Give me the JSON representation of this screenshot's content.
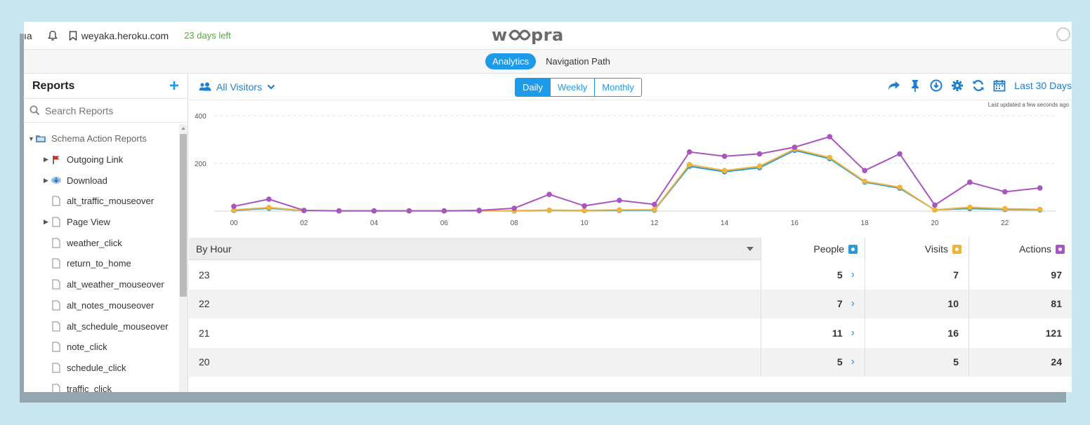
{
  "topbar": {
    "left_fragment": "ıa",
    "domain": "weyaka.heroku.com",
    "days_left": "23 days left",
    "logo": "woopra"
  },
  "subnav": {
    "tabs": [
      {
        "label": "Analytics",
        "active": true
      },
      {
        "label": "Navigation Path",
        "active": false
      }
    ]
  },
  "sidebar": {
    "title": "Reports",
    "search_placeholder": "Search Reports",
    "tree": [
      {
        "label": "Schema Action Reports",
        "icon": "folder-icon",
        "expanded": true,
        "level": 0
      },
      {
        "label": "Outgoing Link",
        "icon": "flag-icon",
        "expandable": true,
        "level": 1
      },
      {
        "label": "Download",
        "icon": "download-icon",
        "expandable": true,
        "level": 1
      },
      {
        "label": "alt_traffic_mouseover",
        "icon": "page-icon",
        "level": 1
      },
      {
        "label": "Page View",
        "icon": "page-icon",
        "expandable": true,
        "level": 1
      },
      {
        "label": "weather_click",
        "icon": "page-icon",
        "level": 1
      },
      {
        "label": "return_to_home",
        "icon": "page-icon",
        "level": 1
      },
      {
        "label": "alt_weather_mouseover",
        "icon": "page-icon",
        "level": 1
      },
      {
        "label": "alt_notes_mouseover",
        "icon": "page-icon",
        "level": 1
      },
      {
        "label": "alt_schedule_mouseover",
        "icon": "page-icon",
        "level": 1
      },
      {
        "label": "note_click",
        "icon": "page-icon",
        "level": 1
      },
      {
        "label": "schedule_click",
        "icon": "page-icon",
        "level": 1
      },
      {
        "label": "traffic_click",
        "icon": "page-icon",
        "level": 1
      }
    ]
  },
  "toolbar": {
    "segment": "All Visitors",
    "periods": [
      "Daily",
      "Weekly",
      "Monthly"
    ],
    "active_period": "Daily",
    "date_range": "Last 30 Days",
    "last_updated": "Last updated a few seconds ago"
  },
  "chart_data": {
    "type": "line",
    "x": [
      "00",
      "01",
      "02",
      "03",
      "04",
      "05",
      "06",
      "07",
      "08",
      "09",
      "10",
      "11",
      "12",
      "13",
      "14",
      "15",
      "16",
      "17",
      "18",
      "19",
      "20",
      "21",
      "22",
      "23"
    ],
    "x_ticks": [
      "00",
      "02",
      "04",
      "06",
      "08",
      "10",
      "12",
      "14",
      "16",
      "18",
      "20",
      "22"
    ],
    "y_ticks": [
      "200",
      "400"
    ],
    "ylim": [
      0,
      400
    ],
    "grid": true,
    "series": [
      {
        "name": "People",
        "color": "#2b9ad6",
        "values": [
          3,
          12,
          2,
          1,
          1,
          1,
          1,
          1,
          1,
          3,
          2,
          3,
          4,
          188,
          165,
          182,
          255,
          220,
          122,
          96,
          5,
          11,
          7,
          5
        ]
      },
      {
        "name": "Visits",
        "color": "#f0b43a",
        "values": [
          5,
          15,
          2,
          1,
          1,
          1,
          1,
          1,
          2,
          4,
          3,
          5,
          6,
          195,
          170,
          188,
          260,
          225,
          125,
          100,
          5,
          16,
          10,
          7
        ]
      },
      {
        "name": "Actions",
        "color": "#a855c0",
        "values": [
          20,
          50,
          3,
          1,
          1,
          1,
          1,
          3,
          12,
          70,
          22,
          45,
          28,
          248,
          230,
          240,
          268,
          312,
          170,
          240,
          25,
          121,
          81,
          97
        ]
      }
    ]
  },
  "table": {
    "group_label": "By Hour",
    "columns": [
      {
        "label": "People",
        "color": "#2b9ad6"
      },
      {
        "label": "Visits",
        "color": "#f0b43a"
      },
      {
        "label": "Actions",
        "color": "#a855c0"
      }
    ],
    "rows": [
      {
        "hour": "23",
        "people": "5",
        "visits": "7",
        "actions": "97"
      },
      {
        "hour": "22",
        "people": "7",
        "visits": "10",
        "actions": "81"
      },
      {
        "hour": "21",
        "people": "11",
        "visits": "16",
        "actions": "121"
      },
      {
        "hour": "20",
        "people": "5",
        "visits": "5",
        "actions": "24"
      }
    ]
  }
}
